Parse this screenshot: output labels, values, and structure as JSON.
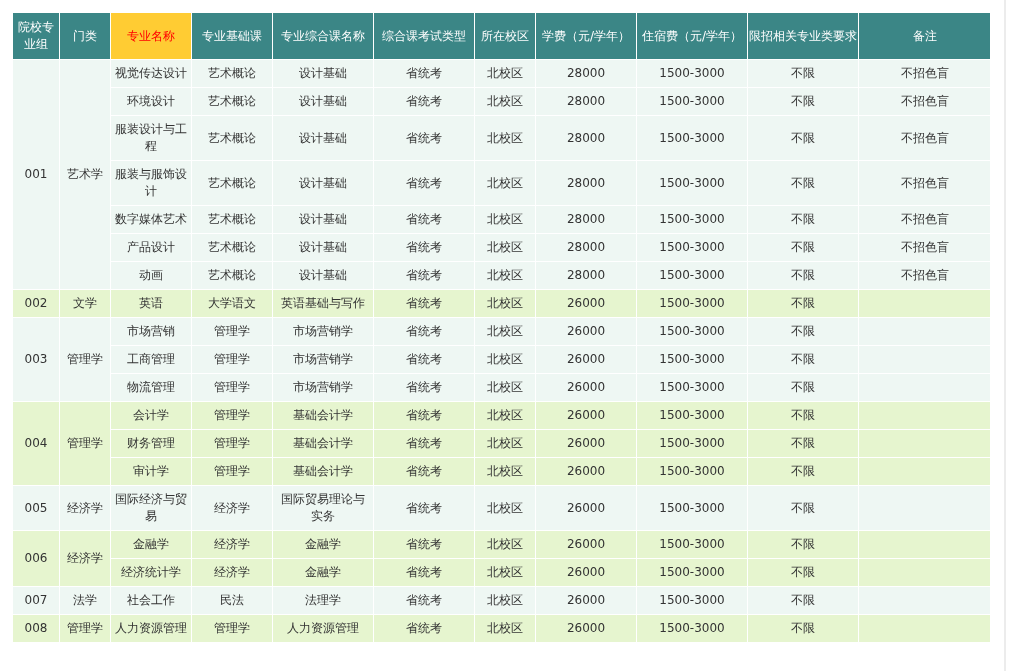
{
  "table": {
    "columns": [
      {
        "label": "院校专业组",
        "highlighted": false
      },
      {
        "label": "门类",
        "highlighted": false
      },
      {
        "label": "专业名称",
        "highlighted": true
      },
      {
        "label": "专业基础课",
        "highlighted": false
      },
      {
        "label": "专业综合课名称",
        "highlighted": false
      },
      {
        "label": "综合课考试类型",
        "highlighted": false
      },
      {
        "label": "所在校区",
        "highlighted": false
      },
      {
        "label": "学费（元/学年）",
        "highlighted": false
      },
      {
        "label": "住宿费（元/学年）",
        "highlighted": false
      },
      {
        "label": "限招相关专业类要求",
        "highlighted": false
      },
      {
        "label": "备注",
        "highlighted": false
      }
    ],
    "groups": [
      {
        "code": "001",
        "category": "艺术学",
        "rows": [
          [
            "视觉传达设计",
            "艺术概论",
            "设计基础",
            "省统考",
            "北校区",
            "28000",
            "1500-3000",
            "不限",
            "不招色盲"
          ],
          [
            "环境设计",
            "艺术概论",
            "设计基础",
            "省统考",
            "北校区",
            "28000",
            "1500-3000",
            "不限",
            "不招色盲"
          ],
          [
            "服装设计与工程",
            "艺术概论",
            "设计基础",
            "省统考",
            "北校区",
            "28000",
            "1500-3000",
            "不限",
            "不招色盲"
          ],
          [
            "服装与服饰设计",
            "艺术概论",
            "设计基础",
            "省统考",
            "北校区",
            "28000",
            "1500-3000",
            "不限",
            "不招色盲"
          ],
          [
            "数字媒体艺术",
            "艺术概论",
            "设计基础",
            "省统考",
            "北校区",
            "28000",
            "1500-3000",
            "不限",
            "不招色盲"
          ],
          [
            "产品设计",
            "艺术概论",
            "设计基础",
            "省统考",
            "北校区",
            "28000",
            "1500-3000",
            "不限",
            "不招色盲"
          ],
          [
            "动画",
            "艺术概论",
            "设计基础",
            "省统考",
            "北校区",
            "28000",
            "1500-3000",
            "不限",
            "不招色盲"
          ]
        ]
      },
      {
        "code": "002",
        "category": "文学",
        "rows": [
          [
            "英语",
            "大学语文",
            "英语基础与写作",
            "省统考",
            "北校区",
            "26000",
            "1500-3000",
            "不限",
            ""
          ]
        ]
      },
      {
        "code": "003",
        "category": "管理学",
        "rows": [
          [
            "市场营销",
            "管理学",
            "市场营销学",
            "省统考",
            "北校区",
            "26000",
            "1500-3000",
            "不限",
            ""
          ],
          [
            "工商管理",
            "管理学",
            "市场营销学",
            "省统考",
            "北校区",
            "26000",
            "1500-3000",
            "不限",
            ""
          ],
          [
            "物流管理",
            "管理学",
            "市场营销学",
            "省统考",
            "北校区",
            "26000",
            "1500-3000",
            "不限",
            ""
          ]
        ]
      },
      {
        "code": "004",
        "category": "管理学",
        "rows": [
          [
            "会计学",
            "管理学",
            "基础会计学",
            "省统考",
            "北校区",
            "26000",
            "1500-3000",
            "不限",
            ""
          ],
          [
            "财务管理",
            "管理学",
            "基础会计学",
            "省统考",
            "北校区",
            "26000",
            "1500-3000",
            "不限",
            ""
          ],
          [
            "审计学",
            "管理学",
            "基础会计学",
            "省统考",
            "北校区",
            "26000",
            "1500-3000",
            "不限",
            ""
          ]
        ]
      },
      {
        "code": "005",
        "category": "经济学",
        "rows": [
          [
            "国际经济与贸易",
            "经济学",
            "国际贸易理论与实务",
            "省统考",
            "北校区",
            "26000",
            "1500-3000",
            "不限",
            ""
          ]
        ]
      },
      {
        "code": "006",
        "category": "经济学",
        "rows": [
          [
            "金融学",
            "经济学",
            "金融学",
            "省统考",
            "北校区",
            "26000",
            "1500-3000",
            "不限",
            ""
          ],
          [
            "经济统计学",
            "经济学",
            "金融学",
            "省统考",
            "北校区",
            "26000",
            "1500-3000",
            "不限",
            ""
          ]
        ]
      },
      {
        "code": "007",
        "category": "法学",
        "rows": [
          [
            "社会工作",
            "民法",
            "法理学",
            "省统考",
            "北校区",
            "26000",
            "1500-3000",
            "不限",
            ""
          ]
        ]
      },
      {
        "code": "008",
        "category": "管理学",
        "rows": [
          [
            "人力资源管理",
            "管理学",
            "人力资源管理",
            "省统考",
            "北校区",
            "26000",
            "1500-3000",
            "不限",
            ""
          ]
        ]
      }
    ]
  }
}
